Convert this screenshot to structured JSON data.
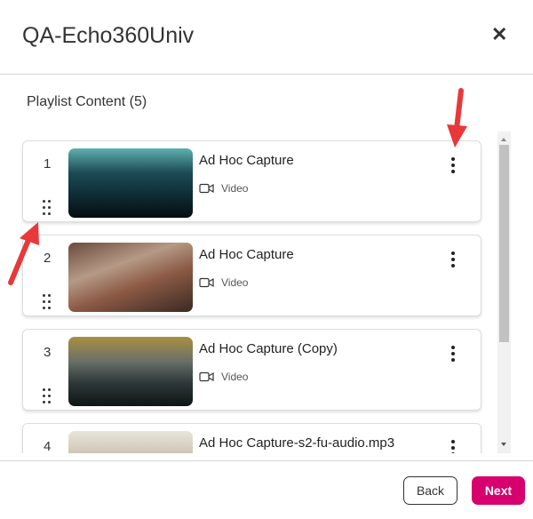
{
  "dialog": {
    "title": "QA-Echo360Univ",
    "close_icon": "close-icon"
  },
  "section_title": "Playlist Content (5)",
  "items": [
    {
      "number": "1",
      "name": "Ad Hoc Capture",
      "type": "Video",
      "thumb": "linear-gradient(180deg,#5fb0b0 0%,#1c4b55 35%,#0e2a33 70%,#050d10 100%)"
    },
    {
      "number": "2",
      "name": "Ad Hoc Capture",
      "type": "Video",
      "thumb": "linear-gradient(160deg,#6b4a3c 0%,#b59a86 35%,#8c5a45 60%,#3a2a22 100%)"
    },
    {
      "number": "3",
      "name": "Ad Hoc Capture (Copy)",
      "type": "Video",
      "thumb": "linear-gradient(180deg,#a89040 0%,#6a7068 35%,#2f3a3a 65%,#0e1414 100%)"
    },
    {
      "number": "4",
      "name": "Ad Hoc Capture-s2-fu-audio.mp3",
      "type": "",
      "thumb": "linear-gradient(180deg,#e8e4d8 0%,#9a8a70 100%)"
    }
  ],
  "footer": {
    "back_label": "Back",
    "next_label": "Next"
  },
  "colors": {
    "accent": "#d6006e",
    "annotation_arrow": "#e8383a"
  }
}
